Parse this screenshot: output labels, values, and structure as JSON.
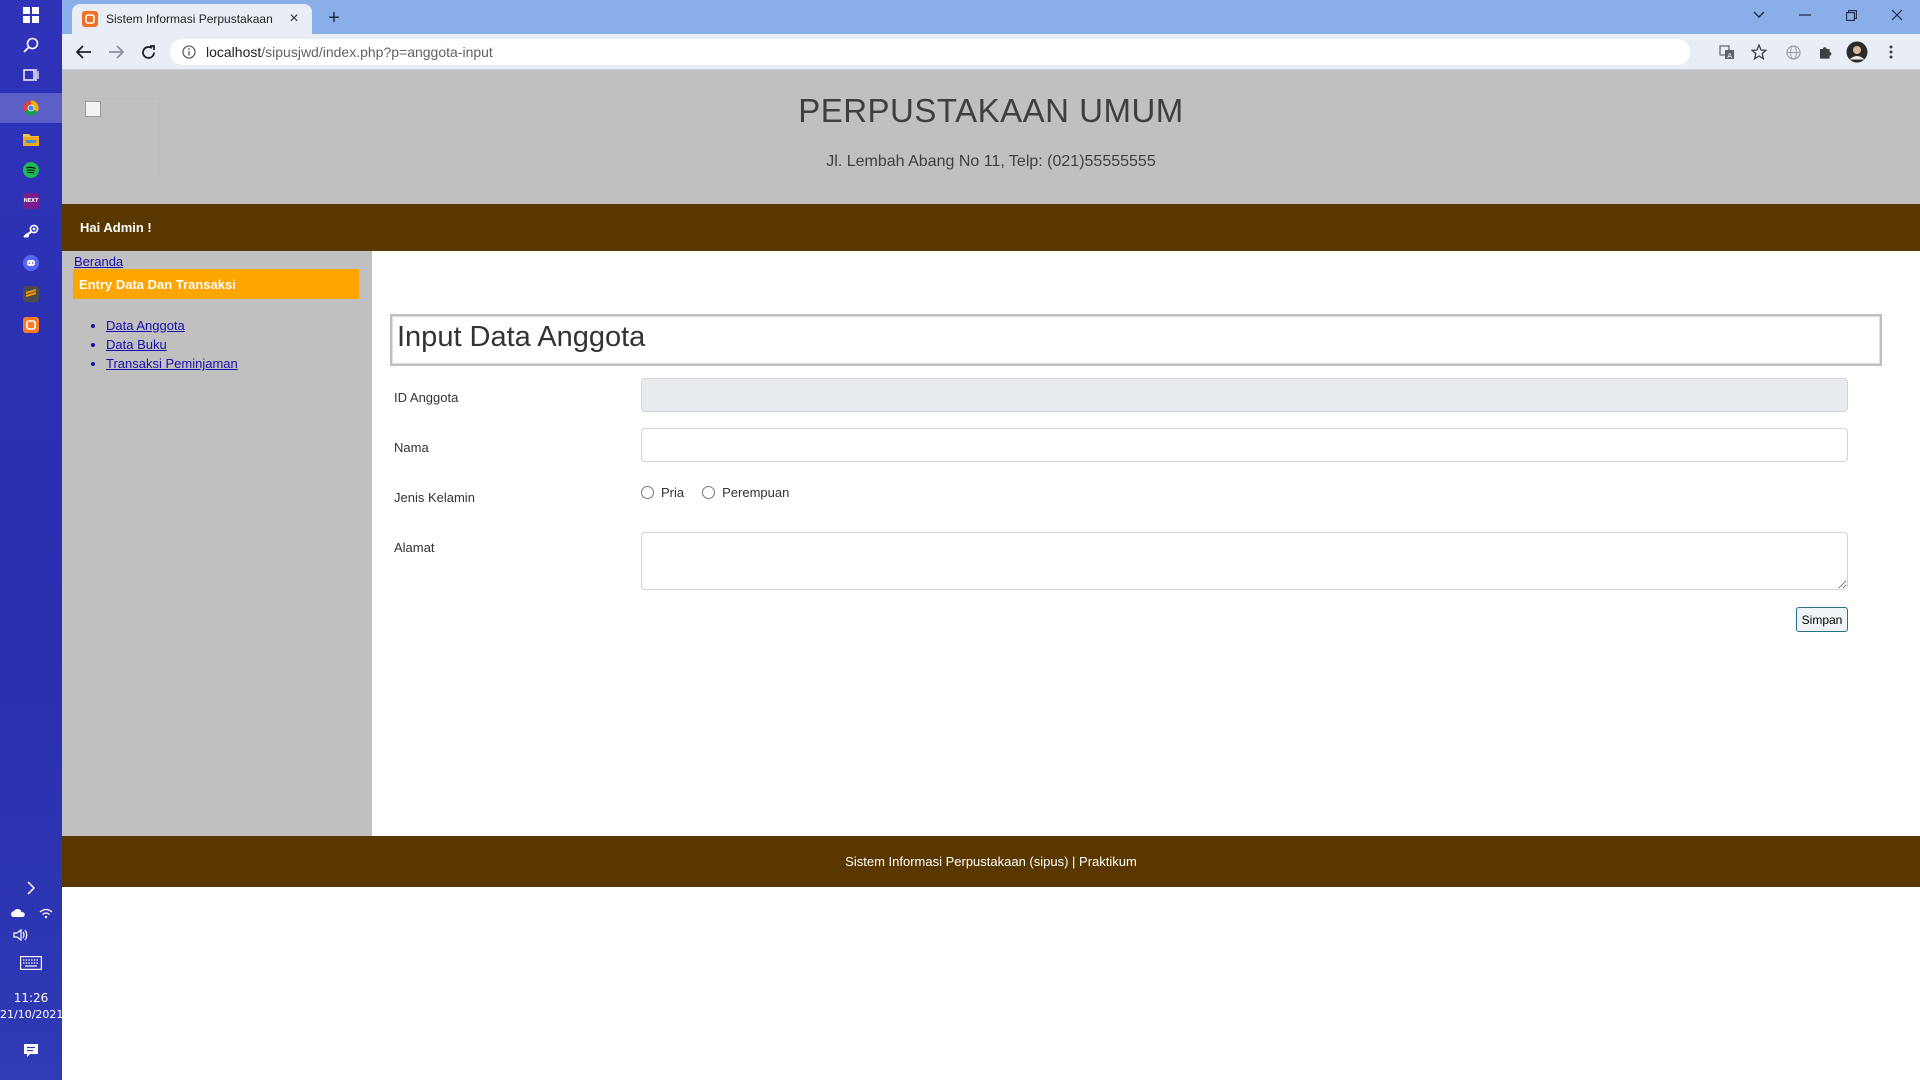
{
  "browser": {
    "tab_title": "Sistem Informasi Perpustakaan",
    "url_host": "localhost",
    "url_path": "/sipusjwd/index.php?p=anggota-input"
  },
  "taskbar": {
    "time": "11:26",
    "date": "21/10/2021",
    "pinned_apps": [
      "chrome",
      "file-explorer",
      "spotify",
      "next",
      "steam",
      "discord",
      "sublime-text",
      "xampp"
    ]
  },
  "header": {
    "title": "PERPUSTAKAAN UMUM",
    "address": "Jl. Lembah Abang No 11, Telp: (021)55555555"
  },
  "userbar": {
    "greeting": "Hai Admin !"
  },
  "sidebar": {
    "home_link": "Beranda",
    "menu_heading": "Entry Data Dan Transaksi",
    "items": [
      {
        "label": "Data Anggota"
      },
      {
        "label": "Data Buku"
      },
      {
        "label": "Transaksi Peminjaman"
      }
    ]
  },
  "form": {
    "title": "Input Data Anggota",
    "id_label": "ID Anggota",
    "id_value": "",
    "name_label": "Nama",
    "name_value": "",
    "gender_label": "Jenis Kelamin",
    "gender_options": [
      "Pria",
      "Perempuan"
    ],
    "address_label": "Alamat",
    "address_value": "",
    "submit_label": "Simpan"
  },
  "footer": {
    "text": "Sistem Informasi Perpustakaan (sipus) | Praktikum"
  },
  "colors": {
    "header_bg": "#c0c0c0",
    "bar_brown": "#5b3700",
    "menu_orange": "#ffa500",
    "taskbar_blue": "#2e33b8",
    "tabstrip_blue": "#8aaee8"
  }
}
